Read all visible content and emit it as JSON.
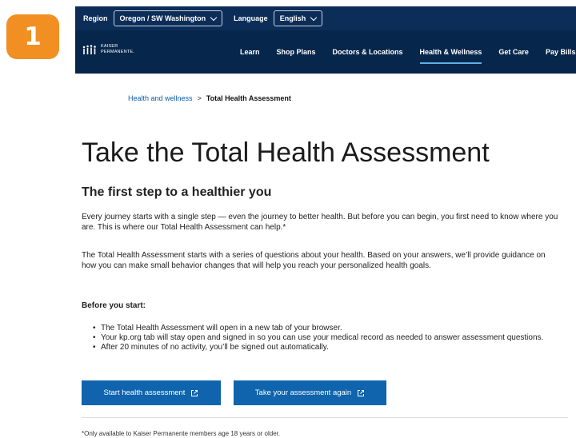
{
  "step_badge": "1",
  "utility_bar": {
    "region_label": "Region",
    "region_value": "Oregon / SW Washington",
    "language_label": "Language",
    "language_value": "English"
  },
  "header": {
    "logo_line1": "KAISER",
    "logo_line2": "PERMANENTE.",
    "nav_items": [
      "Learn",
      "Shop Plans",
      "Doctors & Locations",
      "Health & Wellness",
      "Get Care",
      "Pay Bills"
    ],
    "active_nav": "Health & Wellness"
  },
  "breadcrumb": {
    "parent": "Health and wellness",
    "separator": ">",
    "current": "Total Health Assessment"
  },
  "main": {
    "title": "Take the Total Health Assessment",
    "subtitle": "The first step to a healthier you",
    "paragraph1": "Every journey starts with a single step — even the journey to better health. But before you can begin, you first need to know where you are. This is where our Total Health Assessment can help.*",
    "paragraph2": "The Total Health Assessment starts with a series of questions about your health. Based on your answers, we’ll provide guidance on how you can make small behavior changes that will help you reach your personalized health goals.",
    "before_heading": "Before you start:",
    "bullets": [
      "The Total Health Assessment will open in a new tab of your browser.",
      "Your kp.org tab will stay open and signed in so you can use your medical record as needed to answer assessment questions.",
      "After 20 minutes of no activity, you’ll be signed out automatically."
    ],
    "start_button": "Start health assessment",
    "again_button": "Take your assessment again",
    "footnote": "*Only available to Kaiser Permanente members age 18 years or older."
  },
  "colors": {
    "badge": "#f28f22",
    "utility_bar": "#0b2d58",
    "nav_bar": "#07264c",
    "active_underline": "#59b2e6",
    "link": "#0b5cab",
    "button": "#0f64ad"
  }
}
